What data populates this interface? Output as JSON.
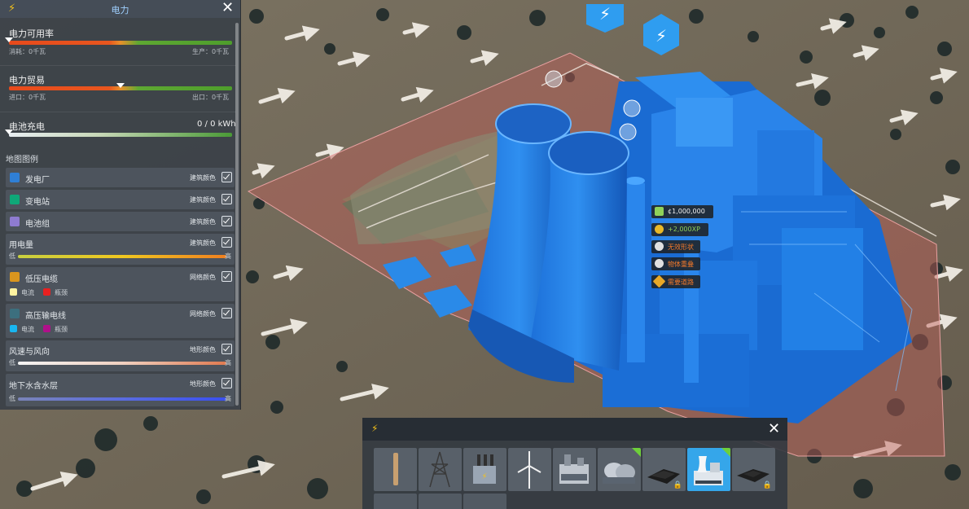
{
  "panel": {
    "title": "电力",
    "close_glyph": "✕",
    "availability": {
      "title": "电力可用率",
      "consumption": "消耗：0千瓦",
      "production": "生产：0千瓦",
      "level": 0.0
    },
    "trade": {
      "title": "电力贸易",
      "import": "进口：0千瓦",
      "export": "出口：0千瓦",
      "level": 0.5
    },
    "battery": {
      "title": "电池充电",
      "value": "0 / 0 kWh",
      "level": 0.0
    },
    "legend": {
      "title": "地图图例",
      "items": [
        {
          "name": "发电厂",
          "mode": "建筑颜色",
          "color": "#2f7fd6"
        },
        {
          "name": "变电站",
          "mode": "建筑颜色",
          "color": "#0fa878"
        },
        {
          "name": "电池组",
          "mode": "建筑颜色",
          "color": "#8e7bd0"
        }
      ],
      "usage": {
        "name": "用电量",
        "mode": "建筑颜色",
        "low": "低",
        "high": "高"
      },
      "low_voltage": {
        "name": "低压电缆",
        "mode": "网络颜色",
        "color": "#d9951e",
        "flow": "电流",
        "bottleneck": "瓶颈",
        "flow_color": "#fff3a0",
        "bottleneck_color": "#e82020"
      },
      "high_voltage": {
        "name": "高压输电线",
        "mode": "网络颜色",
        "color": "#3c6f7e",
        "flow": "电流",
        "bottleneck": "瓶颈",
        "flow_color": "#19b6f0",
        "bottleneck_color": "#b0108a"
      },
      "wind": {
        "name": "风速与风向",
        "mode": "地形颜色",
        "low": "低",
        "high": "高"
      },
      "groundwater": {
        "name": "地下水含水层",
        "mode": "地形颜色",
        "low": "低",
        "high": "高"
      }
    }
  },
  "tooltip": {
    "cost": "¢1,000,000",
    "xp": "+2,000XP",
    "warnings": [
      "无效形状",
      "物体重叠",
      "需要道路"
    ]
  },
  "toolbar": {
    "close_glyph": "✕",
    "tiles": [
      {
        "icon": "pole-icon",
        "locked": false,
        "selected": false,
        "new": false
      },
      {
        "icon": "transmission-tower-icon",
        "locked": false,
        "selected": false,
        "new": false
      },
      {
        "icon": "transformer-icon",
        "locked": false,
        "selected": false,
        "new": false
      },
      {
        "icon": "wind-turbine-icon",
        "locked": false,
        "selected": false,
        "new": false
      },
      {
        "icon": "power-plant-icon",
        "locked": false,
        "selected": false,
        "new": false
      },
      {
        "icon": "gas-plant-icon",
        "locked": false,
        "selected": false,
        "new": true
      },
      {
        "icon": "coal-plant-icon",
        "locked": true,
        "selected": false,
        "new": false
      },
      {
        "icon": "nuclear-plant-icon",
        "locked": false,
        "selected": true,
        "new": true
      },
      {
        "icon": "solar-plant-icon",
        "locked": true,
        "selected": false,
        "new": false
      }
    ]
  },
  "colors": {
    "accent": "#35a6ea",
    "bolt": "#f5c21a",
    "building": "#1e78e0"
  }
}
